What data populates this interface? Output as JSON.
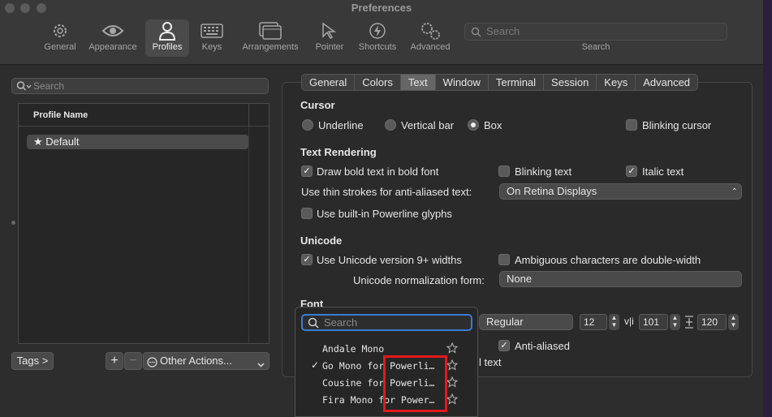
{
  "window": {
    "title": "Preferences"
  },
  "toolbar": {
    "items": [
      {
        "label": "General",
        "icon": "gear-icon"
      },
      {
        "label": "Appearance",
        "icon": "eye-icon"
      },
      {
        "label": "Profiles",
        "icon": "person-icon",
        "active": true
      },
      {
        "label": "Keys",
        "icon": "keyboard-icon"
      },
      {
        "label": "Arrangements",
        "icon": "windows-icon"
      },
      {
        "label": "Pointer",
        "icon": "pointer-icon"
      },
      {
        "label": "Shortcuts",
        "icon": "bolt-icon"
      },
      {
        "label": "Advanced",
        "icon": "gears-icon"
      }
    ],
    "search_placeholder": "Search",
    "search_label": "Search"
  },
  "sidebar": {
    "search_placeholder": "Search",
    "column_header": "Profile Name",
    "profiles": [
      {
        "name": "Default",
        "star": "★"
      }
    ],
    "tags_button": "Tags >",
    "add_button": "+",
    "remove_button": "−",
    "other_actions": "Other Actions..."
  },
  "tabs": [
    {
      "label": "General"
    },
    {
      "label": "Colors"
    },
    {
      "label": "Text",
      "active": true
    },
    {
      "label": "Window"
    },
    {
      "label": "Terminal"
    },
    {
      "label": "Session"
    },
    {
      "label": "Keys"
    },
    {
      "label": "Advanced"
    }
  ],
  "cursor": {
    "title": "Cursor",
    "underline": "Underline",
    "vertical_bar": "Vertical bar",
    "box": "Box",
    "blinking": "Blinking cursor"
  },
  "text_rendering": {
    "title": "Text Rendering",
    "bold": "Draw bold text in bold font",
    "blinking_text": "Blinking text",
    "italic": "Italic text",
    "thin_strokes_label": "Use thin strokes for anti-aliased text:",
    "thin_strokes_value": "On Retina Displays",
    "powerline": "Use built-in Powerline glyphs"
  },
  "unicode": {
    "title": "Unicode",
    "v9_widths": "Use Unicode version 9+ widths",
    "ambiguous": "Ambiguous characters are double-width",
    "normalization_label": "Unicode normalization form:",
    "normalization_value": "None"
  },
  "font": {
    "title": "Font",
    "weight": "Regular",
    "size": "12",
    "hspacing_icon": "v|i",
    "hspacing": "101",
    "vspacing_icon": "vertical-spacing-icon",
    "vspacing": "120",
    "anti_aliased": "Anti-aliased",
    "partial_label": "l text"
  },
  "font_menu": {
    "search_placeholder": "Search",
    "items": [
      {
        "name": "Andale Mono",
        "checked": false
      },
      {
        "name": "Go Mono for Powerli…",
        "checked": true
      },
      {
        "name": "Cousine for Powerli…",
        "checked": false
      },
      {
        "name": "Fira Mono for Power…",
        "checked": false
      }
    ],
    "checkmark": "✓"
  },
  "colors": {
    "highlight": "#e2191c",
    "focus": "#3b7bd3"
  }
}
